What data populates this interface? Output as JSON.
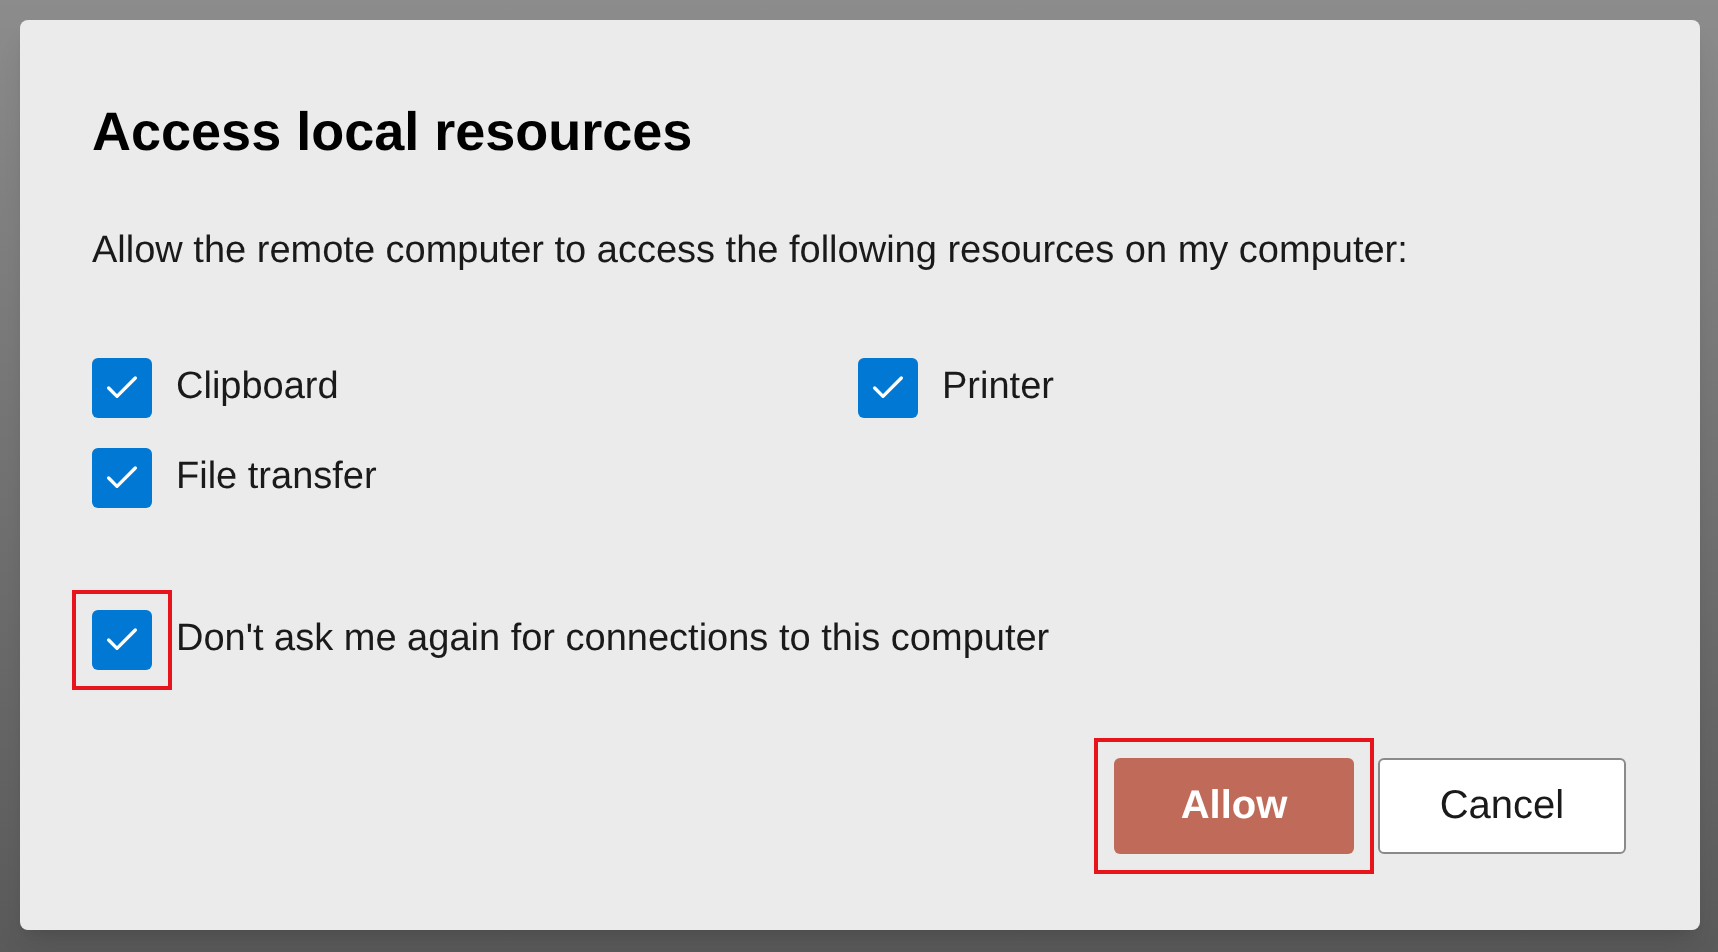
{
  "dialog": {
    "title": "Access local resources",
    "description": "Allow the remote computer to access the following resources on my computer:",
    "resources": [
      {
        "label": "Clipboard",
        "checked": true
      },
      {
        "label": "Printer",
        "checked": true
      },
      {
        "label": "File transfer",
        "checked": true
      }
    ],
    "remember": {
      "label": "Don't ask me again for connections to this computer",
      "checked": true,
      "highlighted": true
    },
    "buttons": [
      {
        "label": "Allow",
        "kind": "primary",
        "highlighted": true
      },
      {
        "label": "Cancel",
        "kind": "secondary",
        "highlighted": false
      }
    ]
  }
}
